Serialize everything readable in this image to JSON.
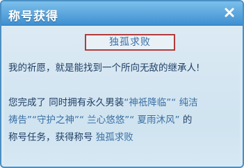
{
  "dialog": {
    "title": "称号获得",
    "close_glyph": "×",
    "close_icon": "close-icon",
    "badge_label": "独孤求败",
    "wish_text": "我的祈愿，就是能找到一个所向无敌的继承人!",
    "completion": {
      "line1_text": "您完成了 同时拥有永久男装",
      "line1_titles": "“神祇降临”“ 纯洁",
      "line2_titles": "祷告”“守护之神”“ 兰心悠悠”“ 夏雨沐风”",
      "line2_suffix": " 的",
      "line3_text": "称号任务，获得称号 ",
      "line3_award": "独孤求败"
    },
    "colors": {
      "titlebar_top": "#7cc0ec",
      "titlebar_bottom": "#3f8fd0",
      "body_bg": "#d9eaf5",
      "badge_border": "#b23a3a",
      "text_dark": "#1f3e64",
      "text_highlight": "#3a6fa3"
    }
  }
}
